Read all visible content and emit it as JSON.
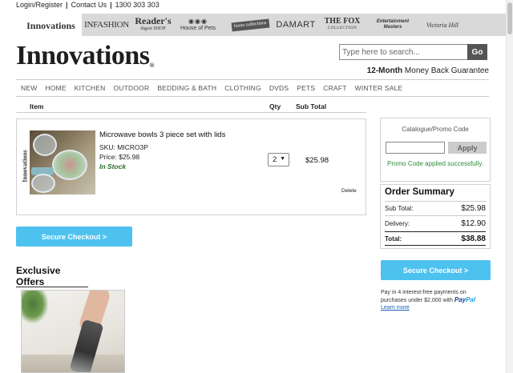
{
  "utility": {
    "login": "Login/Register",
    "contact": "Contact Us",
    "phone": "1300 303 303",
    "sep": "|"
  },
  "brands": {
    "innovations": "Innovations",
    "infashion": "INFASHION",
    "readers_digest": "Reader's",
    "readers_digest_sub": "digest SHOP",
    "house_of_pets": "House of Pets",
    "home_collections": "home collections",
    "damart": "DAMART",
    "fox": "THE FOX",
    "fox_sub": "COLLECTION",
    "entertainment": "Entertainment",
    "entertainment_sub": "Masters",
    "victoria": "Victoria Hill"
  },
  "header": {
    "logo": "Innovations",
    "logo_mark": "®",
    "search_placeholder": "Type here to search...",
    "go_label": "Go",
    "guarantee_bold": "12-Month",
    "guarantee_rest": " Money Back Guarantee"
  },
  "nav": [
    "NEW",
    "HOME",
    "KITCHEN",
    "OUTDOOR",
    "BEDDING & BATH",
    "CLOTHING",
    "DVDS",
    "PETS",
    "CRAFT",
    "WINTER SALE"
  ],
  "cart": {
    "col_item": "Item",
    "col_qty": "Qty",
    "col_subtotal": "Sub Total",
    "vertical_brand": "Innovations",
    "product": {
      "name": "Microwave bowls 3 piece set with lids",
      "sku": "SKU: MICRO3P",
      "price": "Price: $25.98",
      "stock": "In Stock",
      "qty": "2",
      "subtotal": "$25.98",
      "delete": "Delete"
    },
    "checkout": "Secure Checkout >"
  },
  "exclusive": {
    "title": "Exclusive Offers"
  },
  "promo": {
    "label": "Catalogue/Promo Code",
    "input_value": "",
    "apply": "Apply",
    "success": "Promo Code applied successfully."
  },
  "summary": {
    "title": "Order Summary",
    "subtotal_label": "Sub Total:",
    "subtotal": "$25.98",
    "delivery_label": "Delivery:",
    "delivery": "$12.90",
    "total_label": "Total:",
    "total": "$38.88"
  },
  "checkout_right": "Secure Checkout >",
  "paypal": {
    "text": "Pay in 4 interest-free payments on purchases under $2,000 with ",
    "brand_a": "Pay",
    "brand_b": "Pal",
    "learn": "Learn more"
  },
  "colors": {
    "accent": "#4ec2ef",
    "success": "#2e8b3a",
    "stock": "#2b6b2b"
  }
}
